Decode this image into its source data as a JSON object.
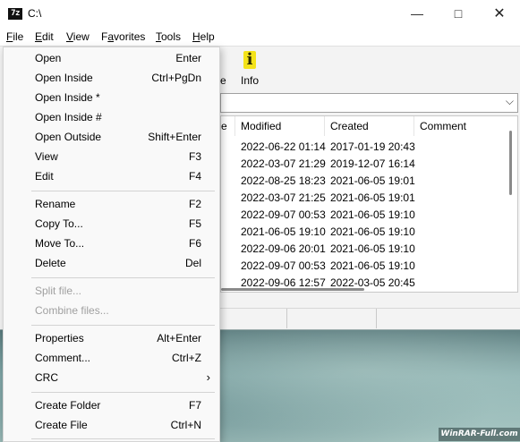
{
  "window": {
    "title": "C:\\",
    "app_icon": "7z"
  },
  "menubar": {
    "file": {
      "pre": "",
      "key": "F",
      "post": "ile"
    },
    "edit": {
      "pre": "",
      "key": "E",
      "post": "dit"
    },
    "view": {
      "pre": "",
      "key": "V",
      "post": "iew"
    },
    "favorites": {
      "pre": "F",
      "key": "a",
      "post": "vorites"
    },
    "tools": {
      "pre": "",
      "key": "T",
      "post": "ools"
    },
    "help": {
      "pre": "",
      "key": "H",
      "post": "elp"
    }
  },
  "toolbar": {
    "partial_label": "e",
    "info_label": "Info",
    "info_glyph": "i"
  },
  "file_list": {
    "columns": {
      "partial": "ze",
      "modified": "Modified",
      "created": "Created",
      "comment": "Comment"
    },
    "rows": [
      {
        "modified": "2022-06-22 01:14",
        "created": "2017-01-19 20:43"
      },
      {
        "modified": "2022-03-07 21:29",
        "created": "2019-12-07 16:14"
      },
      {
        "modified": "2022-08-25 18:23",
        "created": "2021-06-05 19:01"
      },
      {
        "modified": "2022-03-07 21:25",
        "created": "2021-06-05 19:01"
      },
      {
        "modified": "2022-09-07 00:53",
        "created": "2021-06-05 19:10"
      },
      {
        "modified": "2021-06-05 19:10",
        "created": "2021-06-05 19:10"
      },
      {
        "modified": "2022-09-06 20:01",
        "created": "2021-06-05 19:10"
      },
      {
        "modified": "2022-09-07 00:53",
        "created": "2021-06-05 19:10"
      },
      {
        "modified": "2022-09-06 12:57",
        "created": "2022-03-05 20:45"
      }
    ]
  },
  "file_menu": {
    "items": [
      {
        "label": "Open",
        "shortcut": "Enter"
      },
      {
        "label": "Open Inside",
        "shortcut": "Ctrl+PgDn"
      },
      {
        "label": "Open Inside *",
        "shortcut": ""
      },
      {
        "label": "Open Inside #",
        "shortcut": ""
      },
      {
        "label": "Open Outside",
        "shortcut": "Shift+Enter"
      },
      {
        "label": "View",
        "shortcut": "F3"
      },
      {
        "label": "Edit",
        "shortcut": "F4"
      },
      {
        "label": "Rename",
        "shortcut": "F2"
      },
      {
        "label": "Copy To...",
        "shortcut": "F5"
      },
      {
        "label": "Move To...",
        "shortcut": "F6"
      },
      {
        "label": "Delete",
        "shortcut": "Del"
      },
      {
        "label": "Split file...",
        "shortcut": ""
      },
      {
        "label": "Combine files...",
        "shortcut": ""
      },
      {
        "label": "Properties",
        "shortcut": "Alt+Enter"
      },
      {
        "label": "Comment...",
        "shortcut": "Ctrl+Z"
      },
      {
        "label": "CRC",
        "shortcut": ""
      },
      {
        "label": "Create Folder",
        "shortcut": "F7"
      },
      {
        "label": "Create File",
        "shortcut": "Ctrl+N"
      }
    ]
  },
  "watermark": "WinRAR-Full.com"
}
